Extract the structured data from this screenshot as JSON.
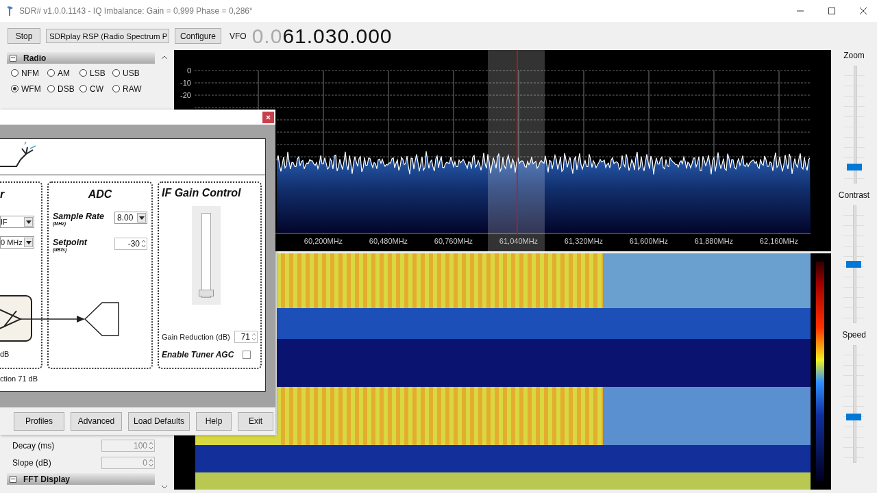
{
  "window": {
    "title": "SDR# v1.0.0.1143 - IQ Imbalance: Gain = 0,999 Phase = 0,286°"
  },
  "toolbar": {
    "start_button": "Stop",
    "device": "SDRplay RSP (Radio Spectrum P",
    "configure_button": "Configure",
    "vfo_label": "VFO",
    "frequency_dim": "0.0",
    "frequency": "61.030.000"
  },
  "side_panel": {
    "radio": {
      "title": "Radio",
      "modes": [
        {
          "label": "NFM",
          "selected": false
        },
        {
          "label": "AM",
          "selected": false
        },
        {
          "label": "LSB",
          "selected": false
        },
        {
          "label": "USB",
          "selected": false
        },
        {
          "label": "WFM",
          "selected": true
        },
        {
          "label": "DSB",
          "selected": false
        },
        {
          "label": "CW",
          "selected": false
        },
        {
          "label": "RAW",
          "selected": false
        }
      ]
    },
    "agc_fields": [
      {
        "label": "Decay (ms)",
        "value": "100"
      },
      {
        "label": "Slope (dB)",
        "value": "0"
      }
    ],
    "next_section": "FFT Display"
  },
  "spectrum": {
    "y_labels": [
      "0",
      "-10",
      "-20"
    ],
    "x_labels": [
      "60,200MHz",
      "60,480MHz",
      "60,760MHz",
      "61,040MHz",
      "61,320MHz",
      "61,600MHz",
      "61,880MHz",
      "62,160MHz"
    ]
  },
  "sliders": [
    {
      "label": "Zoom",
      "level": 0.12
    },
    {
      "label": "Contrast",
      "level": 0.5
    },
    {
      "label": "Speed",
      "level": 0.38
    }
  ],
  "dialog": {
    "tuner": {
      "title": "r",
      "mode": "IF",
      "bandwidth": "0 MHz",
      "gain_note": "dB"
    },
    "adc": {
      "title": "ADC",
      "sample_rate_label": "Sample Rate",
      "sample_rate_unit": "(MHz)",
      "sample_rate": "8.00",
      "setpoint_label": "Setpoint",
      "setpoint_unit": "(dBfs)",
      "setpoint": "-30"
    },
    "if_gain": {
      "title": "IF Gain Control",
      "level": 0.05,
      "gain_reduction_label": "Gain Reduction (dB)",
      "gain_reduction": "71",
      "agc_label": "Enable Tuner AGC",
      "agc_checked": false
    },
    "status": "ction 71 dB",
    "buttons": [
      "Profiles",
      "Advanced",
      "Load Defaults",
      "Help",
      "Exit"
    ]
  }
}
